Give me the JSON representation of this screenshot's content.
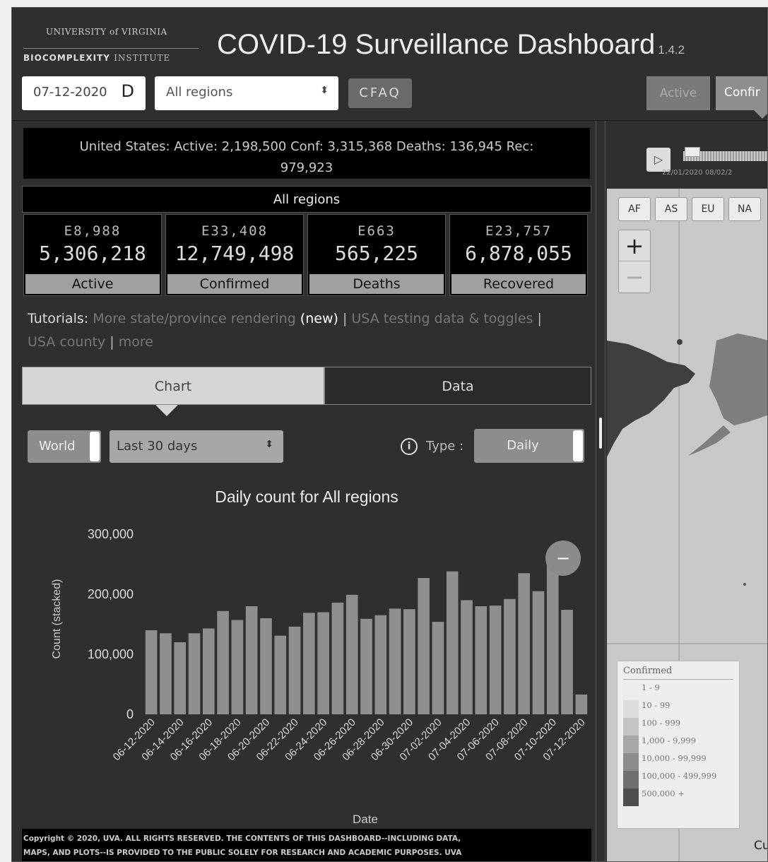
{
  "header": {
    "logo_university": "UNIVERSITY of VIRGINIA",
    "logo_institute_bold": "BIOCOMPLEXITY",
    "logo_institute_thin": "INSTITUTE",
    "title": "COVID-19 Surveillance Dashboard",
    "version": "1.4.2",
    "date_value": "07-12-2020",
    "date_icon": "D",
    "region_select": "All regions",
    "faq_label": "CFAQ",
    "toggle_active": "Active",
    "toggle_confirmed": "Confir"
  },
  "summary": {
    "text": "United States:  Active: 2,198,500 Conf: 3,315,368 Deaths: 136,945 Rec: 979,923"
  },
  "region_header": "All regions",
  "stats": [
    {
      "delta": "E8,988",
      "value": "5,306,218",
      "label": "Active"
    },
    {
      "delta": "E33,408",
      "value": "12,749,498",
      "label": "Confirmed"
    },
    {
      "delta": "E663",
      "value": "565,225",
      "label": "Deaths"
    },
    {
      "delta": "E23,757",
      "value": "6,878,055",
      "label": "Recovered"
    }
  ],
  "tutorials": {
    "label": "Tutorials:",
    "link1": "More state/province rendering",
    "new_tag": " (new)",
    "sep": " | ",
    "link2": "USA testing data & toggles",
    "link3": "USA county",
    "link4": "more"
  },
  "tabs": {
    "chart": "Chart",
    "data": "Data"
  },
  "controls": {
    "world": "World",
    "range": "Last 30 days",
    "type_label": "Type :",
    "type_value": "Daily"
  },
  "chart_data": {
    "type": "bar",
    "title": "Daily count for All regions",
    "xlabel": "Date",
    "ylabel": "Count (stacked)",
    "ylim": [
      0,
      300000
    ],
    "yticks": [
      0,
      100000,
      200000,
      300000
    ],
    "ytick_labels": [
      "0",
      "100,000",
      "200,000",
      "300,000"
    ],
    "categories": [
      "06-12-2020",
      "06-13-2020",
      "06-14-2020",
      "06-15-2020",
      "06-16-2020",
      "06-17-2020",
      "06-18-2020",
      "06-19-2020",
      "06-20-2020",
      "06-21-2020",
      "06-22-2020",
      "06-23-2020",
      "06-24-2020",
      "06-25-2020",
      "06-26-2020",
      "06-27-2020",
      "06-28-2020",
      "06-29-2020",
      "06-30-2020",
      "07-01-2020",
      "07-02-2020",
      "07-03-2020",
      "07-04-2020",
      "07-05-2020",
      "07-06-2020",
      "07-07-2020",
      "07-08-2020",
      "07-09-2020",
      "07-10-2020",
      "07-11-2020",
      "07-12-2020"
    ],
    "xtick_labels": [
      "06-12-2020",
      "06-14-2020",
      "06-16-2020",
      "06-18-2020",
      "06-20-2020",
      "06-22-2020",
      "06-24-2020",
      "06-26-2020",
      "06-28-2020",
      "06-30-2020",
      "07-02-2020",
      "07-04-2020",
      "07-06-2020",
      "07-08-2020",
      "07-10-2020",
      "07-12-2020"
    ],
    "values": [
      140000,
      135000,
      120000,
      135000,
      143000,
      172000,
      157000,
      180000,
      160000,
      131000,
      146000,
      169000,
      170000,
      186000,
      199000,
      159000,
      165000,
      176000,
      175000,
      227000,
      154000,
      238000,
      190000,
      180000,
      181000,
      192000,
      235000,
      205000,
      250000,
      174000,
      33000
    ],
    "grid": false,
    "legend": "none"
  },
  "reset_button": "−",
  "footer": {
    "line1": "Copyright © 2020, UVA. ALL RIGHTS RESERVED.  THE CONTENTS OF THIS DASHBOARD--INCLUDING DATA,",
    "line2": "MAPS, AND PLOTS--IS PROVIDED TO THE PUBLIC SOLELY FOR RESEARCH AND ACADEMIC PURPOSES.  UVA"
  },
  "map": {
    "play_icon": "▷",
    "slider_dates": "22/01/2020  08/02/2",
    "continents": [
      "AF",
      "AS",
      "EU",
      "NA"
    ],
    "zoom_in": "+",
    "zoom_out": "−",
    "legend_title": "Confirmed",
    "legend_items": [
      {
        "label": "1 - 9",
        "color": "#ececec"
      },
      {
        "label": "10 - 99",
        "color": "#dcdcdc"
      },
      {
        "label": "100 - 999",
        "color": "#c4c4c4"
      },
      {
        "label": "1,000 - 9,999",
        "color": "#a8a8a8"
      },
      {
        "label": "10,000 - 99,999",
        "color": "#8c8c8c"
      },
      {
        "label": "100,000 - 499,999",
        "color": "#6e6e6e"
      },
      {
        "label": "500,000 +",
        "color": "#4e4e4e"
      }
    ],
    "corner_text": "Cu"
  }
}
